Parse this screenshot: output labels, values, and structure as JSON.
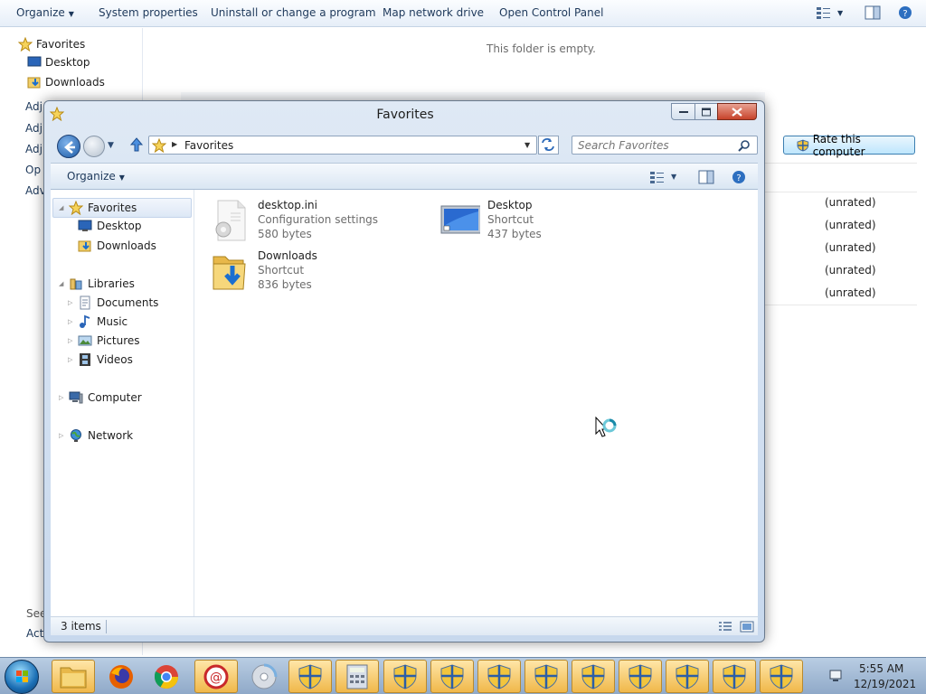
{
  "background_window": {
    "toolbar": {
      "organize": "Organize",
      "system_properties": "System properties",
      "uninstall": "Uninstall or change a program",
      "map_drive": "Map network drive",
      "open_control_panel": "Open Control Panel"
    },
    "nav": {
      "favorites": "Favorites",
      "desktop": "Desktop",
      "downloads": "Downloads",
      "clipped": [
        "Adj",
        "Adj",
        "Adj",
        "Op",
        "Adv"
      ]
    },
    "empty_text": "This folder is empty.",
    "rate_button": "Rate this computer",
    "unrated": [
      "(unrated)",
      "(unrated)",
      "(unrated)",
      "(unrated)",
      "(unrated)"
    ],
    "see_clip": "See",
    "act_clip": "Act"
  },
  "window": {
    "title": "Favorites",
    "address": "Favorites",
    "search_placeholder": "Search Favorites",
    "organize": "Organize",
    "nav": {
      "favorites": "Favorites",
      "desktop": "Desktop",
      "downloads": "Downloads",
      "libraries": "Libraries",
      "documents": "Documents",
      "music": "Music",
      "pictures": "Pictures",
      "videos": "Videos",
      "computer": "Computer",
      "network": "Network"
    },
    "files": [
      {
        "name": "desktop.ini",
        "type": "Configuration settings",
        "size": "580 bytes",
        "icon": "settings-file-icon"
      },
      {
        "name": "Desktop",
        "type": "Shortcut",
        "size": "437 bytes",
        "icon": "desktop-monitor-icon"
      },
      {
        "name": "Downloads",
        "type": "Shortcut",
        "size": "836 bytes",
        "icon": "downloads-folder-icon"
      }
    ],
    "status": "3 items"
  },
  "taskbar": {
    "time": "5:55 AM",
    "date": "12/19/2021"
  },
  "colors": {
    "accent": "#1b5aa5",
    "selection": "#dde8f6",
    "taskbar": "#9fb6d3"
  }
}
